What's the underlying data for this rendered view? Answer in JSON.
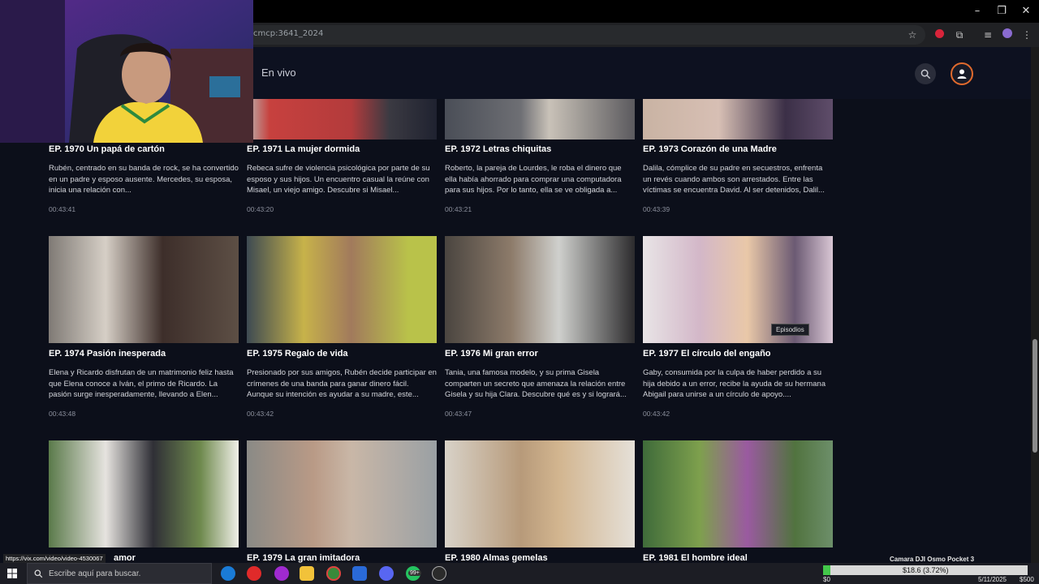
{
  "window": {
    "minimize": "–",
    "restore": "❐",
    "close": "✕"
  },
  "browser": {
    "url_fragment": "cmcp:3641_2024",
    "status_url": "https://vix.com/video/video-4530067"
  },
  "header": {
    "nav_live": "En vivo"
  },
  "episodes": [
    {
      "title": "EP. 1970  Un papá de cartón",
      "desc": "Rubén, centrado en su banda de rock, se ha convertido en un padre y esposo ausente. Mercedes, su esposa, inicia una relación con...",
      "duration": "00:43:41"
    },
    {
      "title": "EP. 1971  La mujer dormida",
      "desc": "Rebeca sufre de violencia psicológica por parte de su esposo y sus hijos. Un encuentro casual la reúne con Misael, un viejo amigo. Descubre si Misael...",
      "duration": "00:43:20"
    },
    {
      "title": "EP. 1972  Letras chiquitas",
      "desc": "Roberto, la pareja de Lourdes, le roba el dinero que ella había ahorrado para comprar una computadora para sus hijos. Por lo tanto, ella se ve obligada a...",
      "duration": "00:43:21"
    },
    {
      "title": "EP. 1973  Corazón de una Madre",
      "desc": "Dalila, cómplice de su padre en secuestros, enfrenta un revés cuando ambos son arrestados. Entre las víctimas se encuentra David. Al ser detenidos, Dalil...",
      "duration": "00:43:39"
    },
    {
      "title": "EP. 1974  Pasión inesperada",
      "desc": "Elena y Ricardo disfrutan de un matrimonio feliz hasta que Elena conoce a Iván, el primo de Ricardo. La pasión surge inesperadamente, llevando a Elen...",
      "duration": "00:43:48"
    },
    {
      "title": "EP. 1975  Regalo de vida",
      "desc": "Presionado por sus amigos, Rubén decide participar en crímenes de una banda para ganar dinero fácil. Aunque su intención es ayudar a su madre, este...",
      "duration": "00:43:42"
    },
    {
      "title": "EP. 1976  Mi gran error",
      "desc": "Tania, una famosa modelo, y su prima Gisela comparten un secreto que amenaza la relación entre Gisela y su hija Clara. Descubre qué es y si logrará...",
      "duration": "00:43:47"
    },
    {
      "title": "EP. 1977  El círculo del engaño",
      "desc": "Gaby, consumida por la culpa de haber perdido a su hija debido a un error, recibe la ayuda de su hermana Abigail para unirse a un círculo de apoyo....",
      "duration": "00:43:42"
    },
    {
      "title": "amor",
      "desc": "",
      "duration": ""
    },
    {
      "title": "EP. 1979  La gran imitadora",
      "desc": "",
      "duration": ""
    },
    {
      "title": "EP. 1980  Almas gemelas",
      "desc": "",
      "duration": ""
    },
    {
      "title": "EP. 1981  El hombre ideal",
      "desc": "",
      "duration": ""
    }
  ],
  "tooltip": "Episodios",
  "taskbar": {
    "search_placeholder": "Escribe aquí para buscar.",
    "badge_count": "99+",
    "camera_label": "Camara DJI Osmo Pocket 3",
    "money_left": "$0",
    "money_center": "$18.6 (3.72%)",
    "money_right": "$500",
    "date": "5/11/2025",
    "progress": 0.0372
  },
  "colors": {
    "accent": "#e06a2d",
    "background": "#0c0f1a",
    "progress": "#43c84a"
  }
}
